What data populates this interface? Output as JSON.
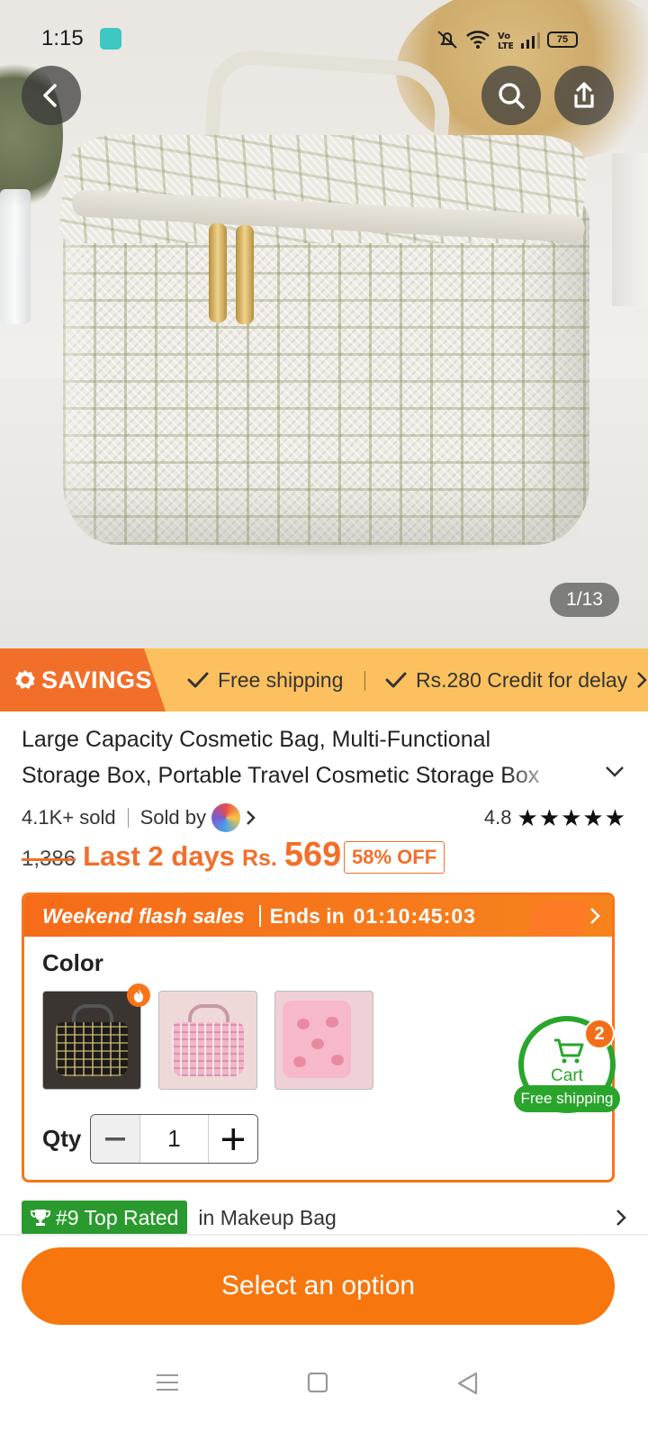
{
  "status_bar": {
    "time": "1:15",
    "battery": "75"
  },
  "gallery": {
    "counter": "1/13",
    "current": 1,
    "total": 13
  },
  "savings": {
    "tag": "SAVINGS",
    "benefits": [
      "Free shipping",
      "Rs.280 Credit for delay"
    ]
  },
  "product": {
    "title": "Large Capacity Cosmetic Bag, Multi-Functional Storage Box, Portable Travel Cosmetic Storage Box",
    "sold": "4.1K+ sold",
    "sold_by": "Sold by",
    "rating": "4.8",
    "stars": "★★★★★",
    "old_price": "1,386",
    "promo_label": "Last 2 days",
    "currency": "Rs.",
    "price": "569",
    "discount": "58% OFF"
  },
  "flash_sale": {
    "title": "Weekend flash sales",
    "ends_label": "Ends in",
    "timer": "01:10:45:03",
    "color_label": "Color",
    "colors": [
      "black tweed",
      "pink tweed",
      "pink peach print"
    ],
    "qty_label": "Qty",
    "qty_value": "1"
  },
  "cart": {
    "label": "Cart",
    "count": "2",
    "badge": "Free shipping"
  },
  "rank": {
    "badge": "#9 Top Rated",
    "category": "in Makeup Bag"
  },
  "cta": {
    "label": "Select an option"
  },
  "colors": {
    "accent_orange": "#f7760e",
    "savings_yellow": "#fcc15e",
    "green": "#2aa52c"
  }
}
